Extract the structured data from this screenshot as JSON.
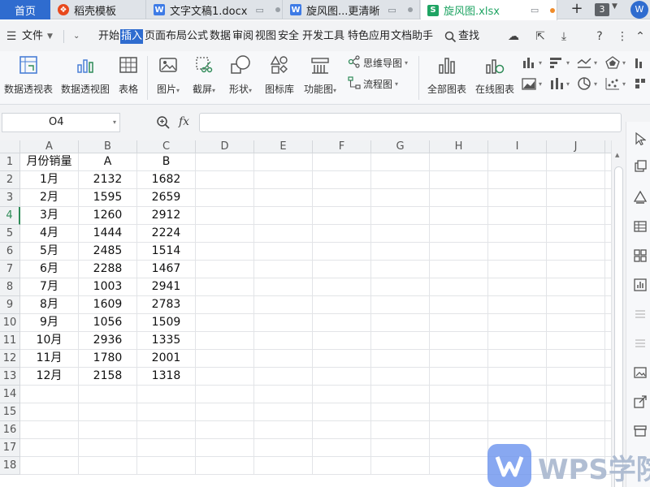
{
  "tabs": {
    "home": "首页",
    "docs": [
      {
        "title": "稻壳模板",
        "icon_color": "#e8491d"
      },
      {
        "title": "文字文稿1.docx",
        "icon_color": "#3e7be6",
        "icon_letter": "W"
      },
      {
        "title": "旋风图...更清晰",
        "icon_color": "#3e7be6",
        "icon_letter": "W"
      },
      {
        "title": "旋风图.xlsx",
        "icon_color": "#1fa463",
        "icon_letter": "S",
        "active": true
      }
    ],
    "count": "3",
    "avatar": "W"
  },
  "menu": {
    "file": "文件",
    "items": [
      "开始",
      "插入",
      "页面布局",
      "公式",
      "数据",
      "审阅",
      "视图",
      "安全",
      "开发工具",
      "特色应用",
      "文档助手"
    ],
    "active": "插入",
    "search": "查找"
  },
  "ribbon": {
    "buttons": [
      "数据透视表",
      "数据透视图",
      "表格",
      "图片",
      "截屏",
      "形状",
      "图标库",
      "功能图",
      "全部图表",
      "在线图表"
    ],
    "small": [
      "思维导图",
      "流程图"
    ]
  },
  "formula": {
    "name_box": "O4",
    "fx": "fx",
    "value": ""
  },
  "sheet": {
    "columns": [
      "A",
      "B",
      "C",
      "D",
      "E",
      "F",
      "G",
      "H",
      "I",
      "J"
    ],
    "row_numbers": [
      "1",
      "2",
      "3",
      "4",
      "5",
      "6",
      "7",
      "8",
      "9",
      "10",
      "11",
      "12",
      "13",
      "14",
      "15",
      "16",
      "17",
      "18"
    ],
    "selected_row": "4",
    "cells": [
      [
        "月份销量",
        "A",
        "B"
      ],
      [
        "1月",
        "2132",
        "1682"
      ],
      [
        "2月",
        "1595",
        "2659"
      ],
      [
        "3月",
        "1260",
        "2912"
      ],
      [
        "4月",
        "1444",
        "2224"
      ],
      [
        "5月",
        "2485",
        "1514"
      ],
      [
        "6月",
        "2288",
        "1467"
      ],
      [
        "7月",
        "1003",
        "2941"
      ],
      [
        "8月",
        "1609",
        "2783"
      ],
      [
        "9月",
        "1056",
        "1509"
      ],
      [
        "10月",
        "2936",
        "1335"
      ],
      [
        "11月",
        "1780",
        "2001"
      ],
      [
        "12月",
        "2158",
        "1318"
      ]
    ]
  },
  "watermark": "WPS学院",
  "colors": {
    "accent": "#2f6ccf",
    "selected_row": "#2e8b57",
    "sheet_icon": "#1fa463"
  }
}
